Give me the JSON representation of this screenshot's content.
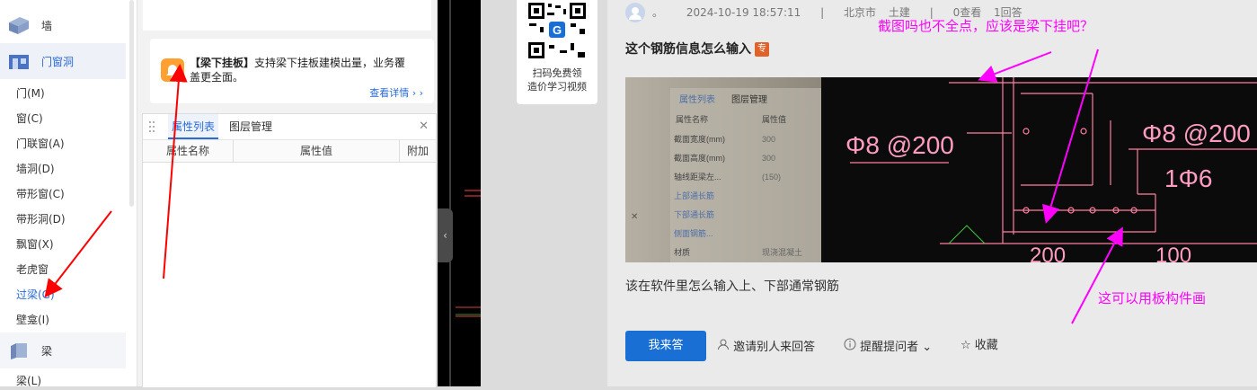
{
  "sidebar": {
    "categories": [
      {
        "label": "墙",
        "icon": "wall-icon"
      },
      {
        "label": "门窗洞",
        "icon": "door-window-icon"
      },
      {
        "label": "梁",
        "icon": "beam-icon"
      }
    ],
    "items": [
      "门(M)",
      "窗(C)",
      "门联窗(A)",
      "墙洞(D)",
      "带形窗(C)",
      "带形洞(D)",
      "飘窗(X)",
      "老虎窗",
      "过梁(G)",
      "壁龛(I)",
      "梁(L)"
    ]
  },
  "promo": {
    "title": "【梁下挂板】",
    "text": "支持梁下挂板建模出量，业务覆盖更全面。",
    "link": "查看详情 › ›"
  },
  "props": {
    "tabs": [
      "属性列表",
      "图层管理"
    ],
    "columns": [
      "属性名称",
      "属性值",
      "附加"
    ]
  },
  "qr": {
    "line1": "扫码免费领",
    "line2": "造价学习视频"
  },
  "post": {
    "author": "。",
    "date": "2024-10-19 18:57:11",
    "sep": "|",
    "location": "北京市",
    "category": "土建",
    "views": "0查看",
    "answers": "1回答",
    "title": "这个钢筋信息怎么输入",
    "tag": "专",
    "body": "该在软件里怎么输入上、下部通常钢筋",
    "answer_button": "我来答",
    "actions": [
      "邀请别人来回答",
      "提醒提问者",
      "收藏"
    ]
  },
  "photo": {
    "panel_tabs": [
      "属性列表",
      "图层管理"
    ],
    "panel_headers": [
      "属性名称",
      "属性值"
    ],
    "panel_rows": [
      [
        "截面宽度(mm)",
        "300"
      ],
      [
        "截面高度(mm)",
        "300"
      ],
      [
        "轴线距梁左...",
        "(150)"
      ],
      [
        "上部通长筋",
        ""
      ],
      [
        "下部通长筋",
        ""
      ],
      [
        "侧面钢筋...",
        ""
      ],
      [
        "材质",
        "现浇混凝土"
      ]
    ],
    "cad_labels": [
      "Φ8 @200",
      "Φ8 @200",
      "1Φ6",
      "200",
      "100"
    ]
  },
  "annotations": {
    "top": "截图吗也不全点，应该是梁下挂吧？",
    "bottom": "这可以用板构件画"
  },
  "colors": {
    "accent": "#2a6bd5",
    "annotation": "#ff00ff",
    "arrow": "#ff0000"
  }
}
